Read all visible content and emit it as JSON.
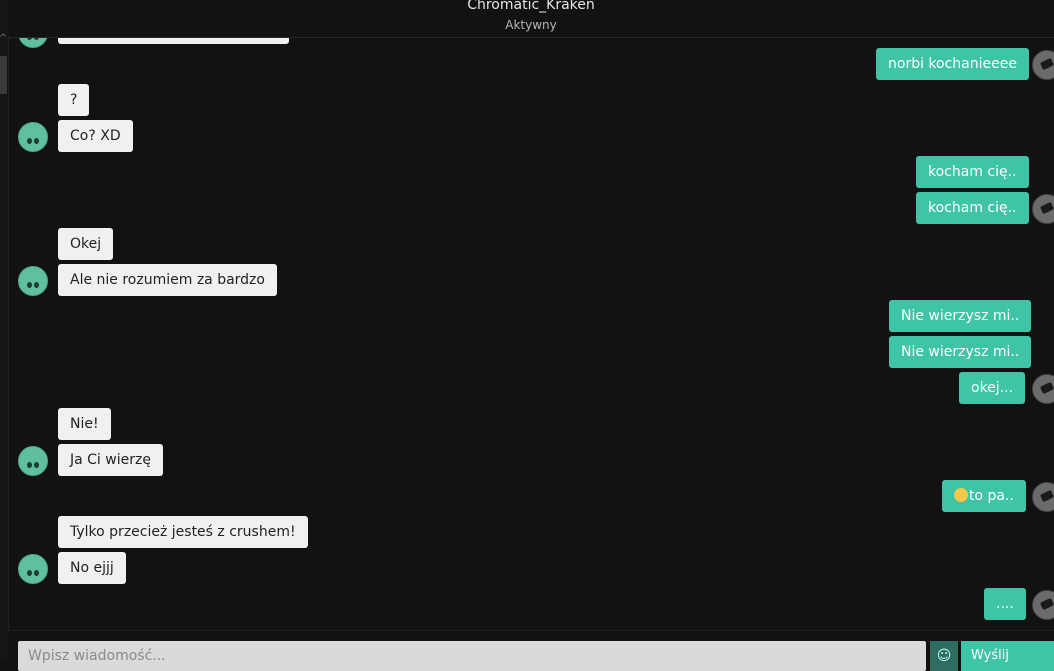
{
  "header": {
    "contact_name": "Chromatic_Kraken",
    "status": "Aktywny"
  },
  "messages": [
    {
      "dir": "in",
      "text": ""
    },
    {
      "dir": "out",
      "text": "norbi kochanieeee"
    },
    {
      "dir": "in",
      "text": "?"
    },
    {
      "dir": "in",
      "text": "Co? XD"
    },
    {
      "dir": "out",
      "text": "kocham cię.."
    },
    {
      "dir": "out",
      "text": "kocham cię.."
    },
    {
      "dir": "in",
      "text": "Okej"
    },
    {
      "dir": "in",
      "text": "Ale nie rozumiem za bardzo"
    },
    {
      "dir": "out",
      "text": "Nie wierzysz mi.."
    },
    {
      "dir": "out",
      "text": "Nie wierzysz mi.."
    },
    {
      "dir": "out",
      "text": "okej..."
    },
    {
      "dir": "in",
      "text": "Nie!"
    },
    {
      "dir": "in",
      "text": "Ja Ci wierzę"
    },
    {
      "dir": "out",
      "text": "to pa..",
      "emoji": "relieved-face-emoji"
    },
    {
      "dir": "in",
      "text": "Tylko przecież jesteś z crushem!"
    },
    {
      "dir": "in",
      "text": "No ejjj"
    },
    {
      "dir": "out",
      "text": "...."
    }
  ],
  "composer": {
    "placeholder": "Wpisz wiadomość...",
    "send_label": "Wyślij"
  },
  "colors": {
    "background": "#121212",
    "outgoing": "#40c4a6",
    "incoming": "#f0f0f0"
  }
}
